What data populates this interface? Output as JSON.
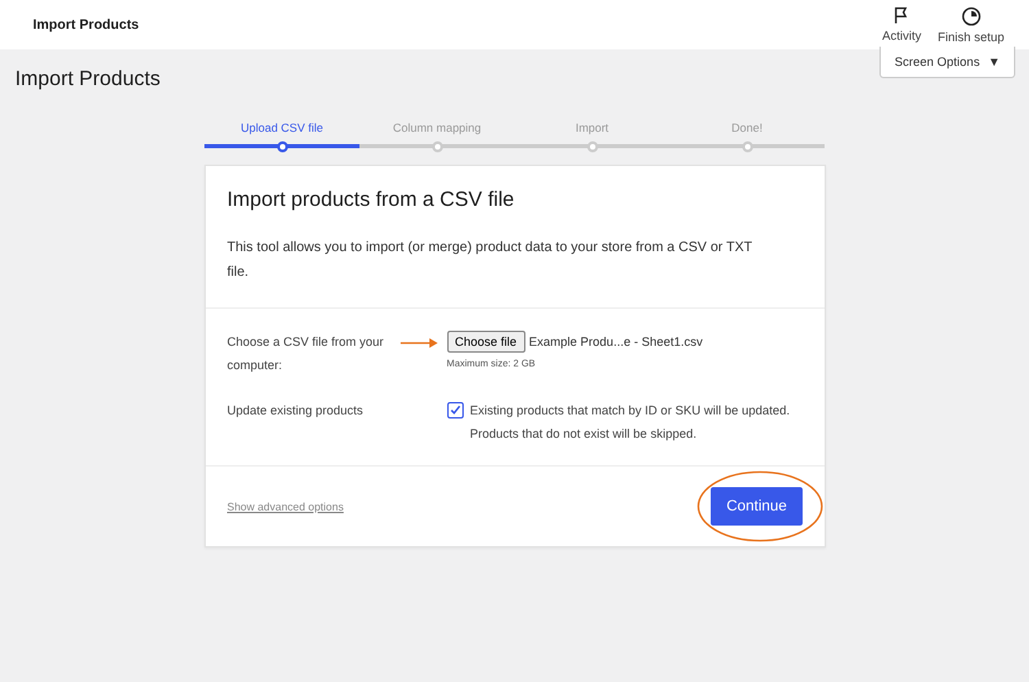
{
  "topbar": {
    "title": "Import Products",
    "actions": [
      {
        "kind": "flag",
        "label": "Activity"
      },
      {
        "kind": "progress",
        "label": "Finish setup"
      }
    ]
  },
  "screen_options": {
    "label": "Screen Options",
    "caret": "▼"
  },
  "page_title": "Import Products",
  "steps": [
    {
      "label": "Upload CSV file",
      "selected": true
    },
    {
      "label": "Column mapping",
      "selected": false
    },
    {
      "label": "Import",
      "selected": false
    },
    {
      "label": "Done!",
      "selected": false
    }
  ],
  "card": {
    "title": "Import products from a CSV file",
    "description": "This tool allows you to import (or merge) product data to your store from a CSV or TXT file.",
    "file_row": {
      "label": "Choose a CSV file from your computer:",
      "button": "Choose file",
      "file_name": "Example Produ...e - Sheet1.csv",
      "hint": "Maximum size: 2 GB"
    },
    "update_row": {
      "label": "Update existing products",
      "checked": true,
      "text": "Existing products that match by ID or SKU will be updated. Products that do not exist will be skipped."
    },
    "advanced_link": "Show advanced options",
    "continue": "Continue"
  }
}
